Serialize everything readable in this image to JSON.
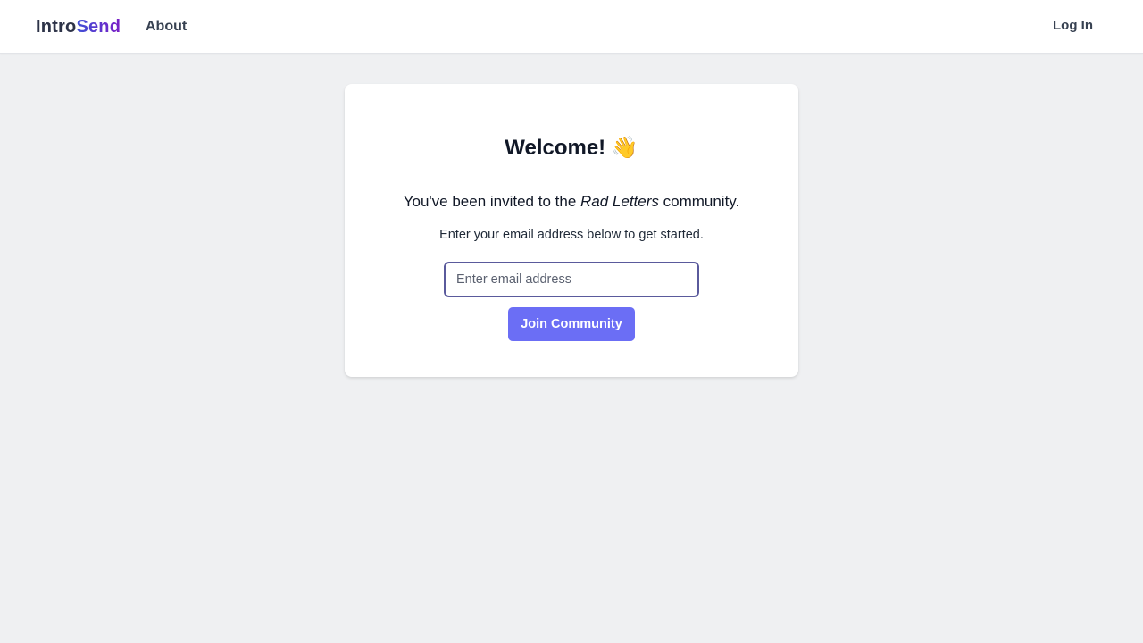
{
  "nav": {
    "logo_part1": "Intro",
    "logo_part2": "Send",
    "about_label": "About",
    "login_label": "Log In"
  },
  "card": {
    "title": "Welcome!",
    "title_emoji": "👋",
    "invite_prefix": "You've been invited to the ",
    "community_name": "Rad Letters",
    "invite_suffix": " community.",
    "instructions": "Enter your email address below to get started.",
    "email_placeholder": "Enter email address",
    "email_value": "",
    "join_label": "Join Community"
  },
  "colors": {
    "background": "#eff0f2",
    "accent_button": "#6b6ef5",
    "input_border": "#5a5a9c",
    "logo_gradient_start": "#3d4fd6",
    "logo_gradient_end": "#7b1fc6"
  },
  "icons": {
    "wave": "waving-hand-icon"
  }
}
